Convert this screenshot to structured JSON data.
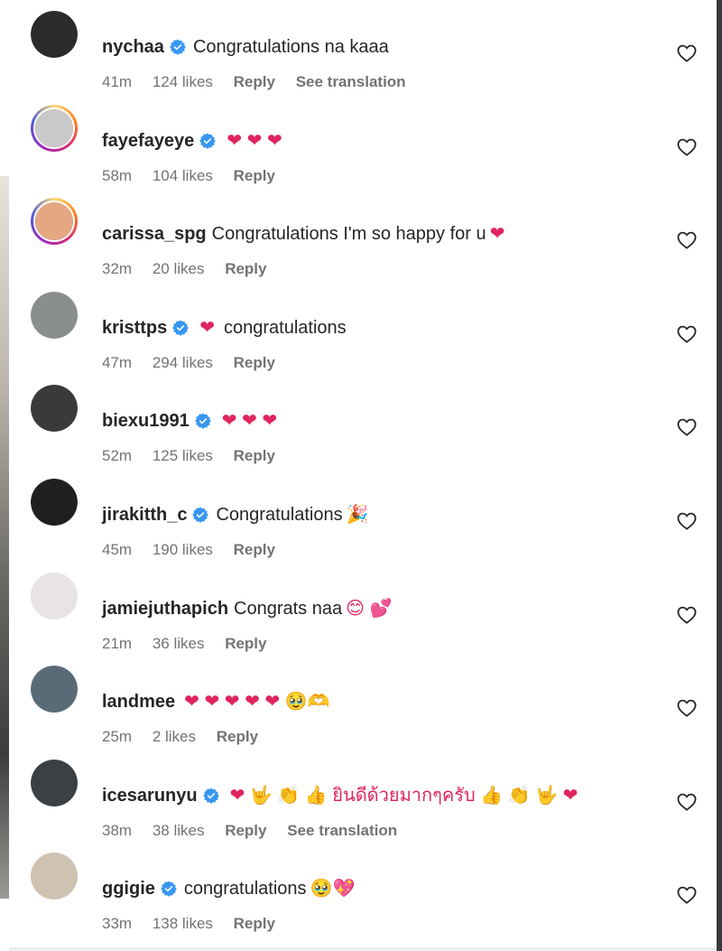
{
  "comments": [
    {
      "username": "nychaa",
      "verified": true,
      "text": "Congratulations na kaaa",
      "emojis": "",
      "time": "41m",
      "likes": "124 likes",
      "reply": "Reply",
      "translate": "See translation",
      "ring": false,
      "avatar_color": "#2b2b2b"
    },
    {
      "username": "fayefayeye",
      "verified": true,
      "text": "",
      "emojis": "❤ ❤ ❤",
      "time": "58m",
      "likes": "104 likes",
      "reply": "Reply",
      "translate": "",
      "ring": true,
      "avatar_color": "#c9c9c9"
    },
    {
      "username": "carissa_spg",
      "verified": false,
      "text": "Congratulations I'm so happy for u",
      "emojis": "❤",
      "time": "32m",
      "likes": "20 likes",
      "reply": "Reply",
      "translate": "",
      "ring": true,
      "avatar_color": "#e3a882"
    },
    {
      "username": "kristtps",
      "verified": true,
      "text": "congratulations",
      "emojis": "❤",
      "emoji_first": true,
      "time": "47m",
      "likes": "294 likes",
      "reply": "Reply",
      "translate": "",
      "ring": false,
      "avatar_color": "#8a8f8e"
    },
    {
      "username": "biexu1991",
      "verified": true,
      "text": "",
      "emojis": "❤ ❤ ❤",
      "time": "52m",
      "likes": "125 likes",
      "reply": "Reply",
      "translate": "",
      "ring": false,
      "avatar_color": "#3a3a3a"
    },
    {
      "username": "jirakitth_c",
      "verified": true,
      "text": "Congratulations",
      "emojis": "🎉",
      "time": "45m",
      "likes": "190 likes",
      "reply": "Reply",
      "translate": "",
      "ring": false,
      "avatar_color": "#1f1f1f"
    },
    {
      "username": "jamiejuthapich",
      "verified": false,
      "text": "Congrats naa",
      "emojis": "😊 💕",
      "time": "21m",
      "likes": "36 likes",
      "reply": "Reply",
      "translate": "",
      "ring": false,
      "avatar_color": "#e9e2e6"
    },
    {
      "username": "landmee",
      "verified": false,
      "text": "",
      "emojis": "❤ ❤ ❤ ❤ ❤ 🥹🫶",
      "time": "25m",
      "likes": "2 likes",
      "reply": "Reply",
      "translate": "",
      "ring": false,
      "avatar_color": "#5a6b78"
    },
    {
      "username": "icesarunyu",
      "verified": true,
      "text": "",
      "emojis": "❤ 🤟 👏 👍 ยินดีด้วยมากๆครับ 👍 👏 🤟 ❤",
      "time": "38m",
      "likes": "38 likes",
      "reply": "Reply",
      "translate": "See translation",
      "ring": false,
      "avatar_color": "#3c3f44"
    },
    {
      "username": "ggigie",
      "verified": true,
      "text": "congratulations",
      "emojis": "🥹💖",
      "time": "33m",
      "likes": "138 likes",
      "reply": "Reply",
      "translate": "",
      "ring": false,
      "avatar_color": "#cfc2b0"
    }
  ],
  "icons": {
    "verified": "verified-badge-icon",
    "like": "heart-outline-icon"
  },
  "colors": {
    "verified_blue": "#3897f0",
    "heart_red": "#ed4956",
    "meta_gray": "#737373"
  }
}
